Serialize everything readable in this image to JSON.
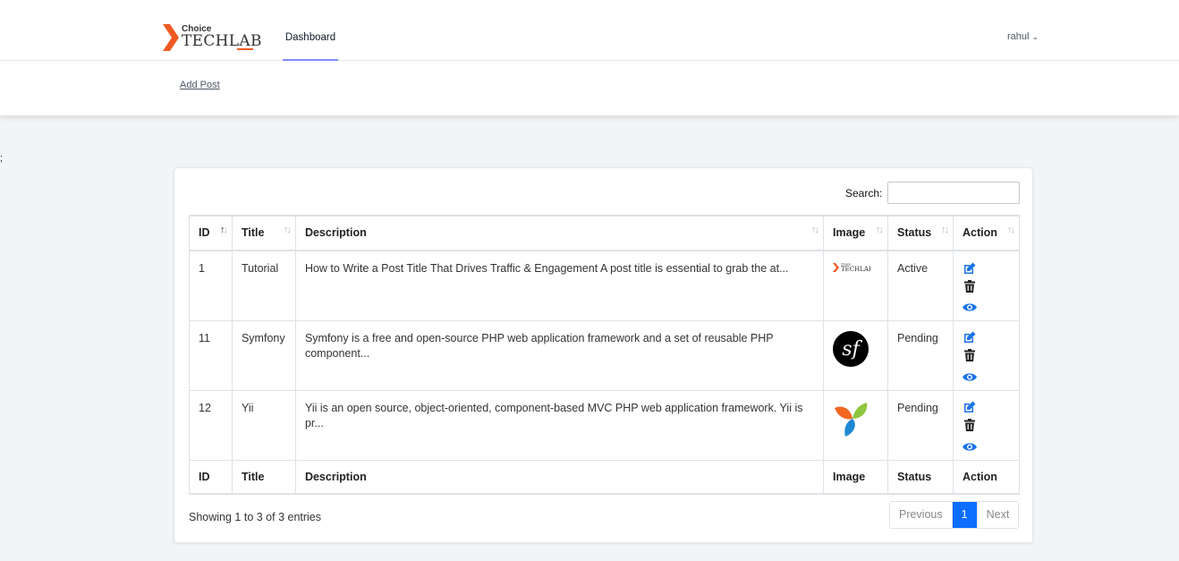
{
  "page": {
    "stray_mark": ";"
  },
  "brand": {
    "small": "Choice",
    "large": "TECHLAB"
  },
  "nav": {
    "dashboard": "Dashboard",
    "user": "rahul",
    "user_chevron": "⌄"
  },
  "subnav": {
    "add_post": "Add Post"
  },
  "table_ui": {
    "search_label": "Search:",
    "search_value": "",
    "columns": [
      "ID",
      "Title",
      "Description",
      "Image",
      "Status",
      "Action"
    ],
    "footer": [
      "ID",
      "Title",
      "Description",
      "Image",
      "Status",
      "Action"
    ],
    "rows": [
      {
        "id": "1",
        "title": "Tutorial",
        "description": "How to Write a Post Title That Drives Traffic & Engagement A post title is essential to grab the at...",
        "image": "choice-techlab-logo",
        "status": "Active"
      },
      {
        "id": "11",
        "title": "Symfony",
        "description": "Symfony is a free and open-source PHP web application framework and a set of reusable PHP component...",
        "image": "symfony-logo",
        "status": "Pending"
      },
      {
        "id": "12",
        "title": "Yii",
        "description": "Yii is an open source, object-oriented, component-based MVC PHP web application framework. Yii is pr...",
        "image": "yii-logo",
        "status": "Pending"
      }
    ],
    "info": "Showing 1 to 3 of 3 entries",
    "pager": {
      "previous": "Previous",
      "current": "1",
      "next": "Next"
    }
  },
  "colors": {
    "accent": "#0d6efd",
    "brand_orange": "#f05a22",
    "nav_underline": "#818cf8",
    "background": "#f3f4f6"
  },
  "icons": {
    "edit": "edit-icon",
    "delete": "trash-icon",
    "view": "eye-icon",
    "sort": "sort-icon"
  }
}
